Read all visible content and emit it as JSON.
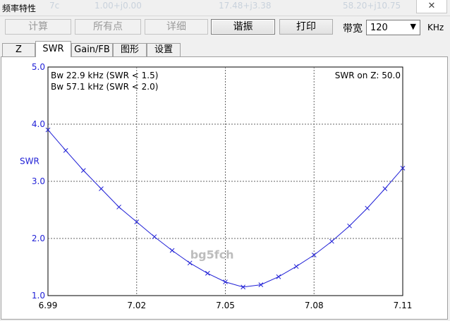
{
  "window": {
    "title": "频率特性",
    "ghost_values": [
      "7c",
      "1.00+j0.00",
      "17.48+j3.38",
      "58.20+j10.75"
    ]
  },
  "toolbar": {
    "calc": "计算",
    "all_points": "所有点",
    "details": "详细",
    "resonance": "谐振",
    "print": "打印",
    "bandwidth_label": "带宽",
    "bandwidth_value": "120",
    "bandwidth_unit": "KHz"
  },
  "tabs": [
    "Z",
    "SWR",
    "Gain/FB",
    "图形",
    "设置"
  ],
  "chart_data": {
    "type": "line",
    "ylabel": "SWR",
    "xlim": [
      6.99,
      7.11
    ],
    "ylim": [
      1.0,
      5.0
    ],
    "x_ticks": [
      "6.99",
      "7.02",
      "7.05",
      "7.08",
      "7.11"
    ],
    "y_ticks": [
      "5.0",
      "4.0",
      "3.0",
      "2.0",
      "1.0"
    ],
    "grid": true,
    "annotations": [
      "Bw 22.9 kHz (SWR < 1.5)",
      "Bw 57.1 kHz (SWR < 2.0)"
    ],
    "annotation_right": "SWR on Z: 50.0",
    "watermark": "bg5fch",
    "series": [
      {
        "color": "#1f1fd6",
        "x": [
          6.99,
          6.996,
          7.002,
          7.008,
          7.014,
          7.02,
          7.026,
          7.032,
          7.038,
          7.044,
          7.05,
          7.056,
          7.062,
          7.068,
          7.074,
          7.08,
          7.086,
          7.092,
          7.098,
          7.104,
          7.11
        ],
        "y": [
          3.9,
          3.54,
          3.19,
          2.87,
          2.55,
          2.29,
          2.03,
          1.79,
          1.57,
          1.39,
          1.24,
          1.15,
          1.19,
          1.33,
          1.51,
          1.71,
          1.95,
          2.22,
          2.53,
          2.87,
          3.23
        ]
      }
    ]
  }
}
